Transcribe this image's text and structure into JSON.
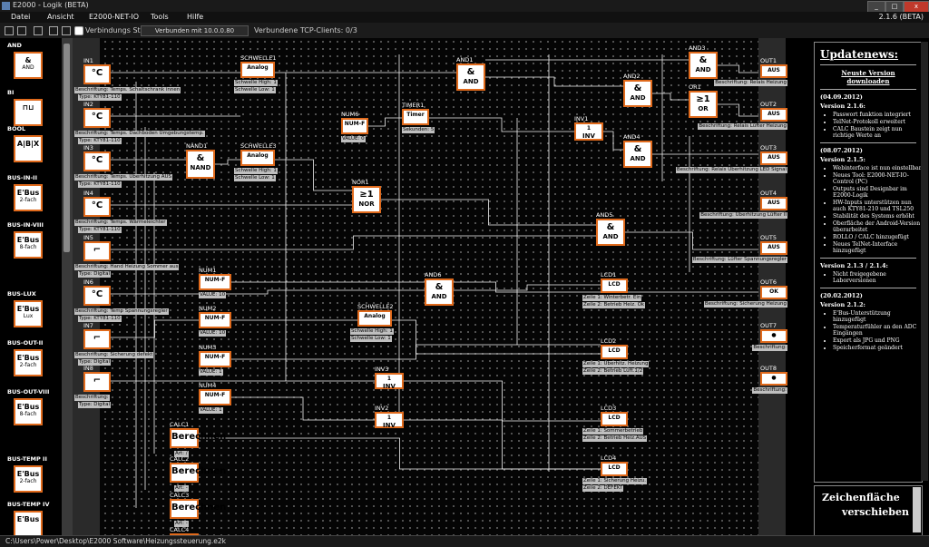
{
  "window": {
    "title": "E2000 - Logik (BETA)",
    "version": "2.1.6 (BETA)",
    "btn_min": "_",
    "btn_max": "□",
    "btn_close": "x"
  },
  "menu": [
    "Datei",
    "Ansicht",
    "E2000-NET-IO",
    "Tools",
    "Hilfe"
  ],
  "toolbar": {
    "status_label": "Verbindungs Status:",
    "status_value": "Verbunden mit 10.0.0.80",
    "tcp_clients": "Verbundene TCP-Clients: 0/3"
  },
  "palette": [
    {
      "cat": "AND",
      "sym": "&",
      "sub": "AND"
    },
    {
      "cat": "BI",
      "sym": "⊓⊔",
      "sub": ""
    },
    {
      "cat": "BOOL",
      "sym": "A|B|X",
      "sub": ""
    },
    {
      "cat": "BUS-IN-II",
      "sym": "E'Bus",
      "sub": "2-fach"
    },
    {
      "cat": "BUS-IN-VIII",
      "sym": "E'Bus",
      "sub": "8-fach"
    },
    {
      "cat": "BUS-LUX",
      "sym": "E'Bus",
      "sub": "Lux"
    },
    {
      "cat": "BUS-OUT-II",
      "sym": "E'Bus",
      "sub": "2-fach"
    },
    {
      "cat": "BUS-OUT-VIII",
      "sym": "E'Bus",
      "sub": "8-fach"
    },
    {
      "cat": "BUS-TEMP II",
      "sym": "E'Bus",
      "sub": "2-fach"
    },
    {
      "cat": "BUS-TEMP IV",
      "sym": "E'Bus",
      "sub": ""
    }
  ],
  "inputs": [
    {
      "name": "IN1",
      "sym": "°C",
      "sub": "KTY110",
      "desc": "Beschriftung: Temps. Schaltschrank innen",
      "type": "Type: KTY81-110"
    },
    {
      "name": "IN2",
      "sym": "°C",
      "sub": "KTY110",
      "desc": "Beschriftung: Temps. Dachboden Umgebungstemp.",
      "type": "Type: KTY81-110"
    },
    {
      "name": "IN3",
      "sym": "°C",
      "sub": "KTY110",
      "desc": "Beschriftung: Temps. Überhitzung AUS",
      "type": "Type: KTY81-110"
    },
    {
      "name": "IN4",
      "sym": "°C",
      "sub": "KTY110",
      "desc": "Beschriftung: Temps. Wärmeleichter",
      "type": "Type: KTY81-110"
    },
    {
      "name": "IN5",
      "sym": "⌐",
      "sub": "",
      "desc": "Beschriftung: Hand Heizung Sommer aus",
      "type": "Type: Digital"
    },
    {
      "name": "IN6",
      "sym": "°C",
      "sub": "KTY110",
      "desc": "Beschriftung: Temp Spannungsregler",
      "type": "Type: KTY81-110"
    },
    {
      "name": "IN7",
      "sym": "⌐",
      "sub": "",
      "desc": "Beschriftung: Sicherung defekt",
      "type": "Type: Digital"
    },
    {
      "name": "IN8",
      "sym": "⌐",
      "sub": "",
      "desc": "Beschriftung:",
      "type": "Type: Digital"
    }
  ],
  "outputs": [
    {
      "name": "OUT1",
      "sym": "AUS",
      "desc": "Beschriftung: Relais Heizung"
    },
    {
      "name": "OUT2",
      "sym": "AUS",
      "desc": "Beschriftung: Relais Lüfter Heizung"
    },
    {
      "name": "OUT3",
      "sym": "AUS",
      "desc": "Beschriftung: Relais Überhitzung LED Signal"
    },
    {
      "name": "OUT4",
      "sym": "AUS",
      "desc": "Beschriftung: Überhitzung Lüfter II"
    },
    {
      "name": "OUT5",
      "sym": "AUS",
      "desc": "Beschriftung: Lüfter Spannungsregler"
    },
    {
      "name": "OUT6",
      "sym": "OK",
      "desc": "Beschriftung: Sicherung Heizung"
    },
    {
      "name": "OUT7",
      "sym": "●",
      "desc": "Beschriftung:"
    },
    {
      "name": "OUT8",
      "sym": "●",
      "desc": "Beschriftung:"
    }
  ],
  "blocks": {
    "schwelle1": {
      "name": "SCHWELLE1",
      "sym": "Analog",
      "n1": "Schwelle High: 1",
      "n2": "Schwelle Low: 1"
    },
    "schwelle3": {
      "name": "SCHWELLE3",
      "sym": "Analog",
      "n1": "Schwelle High: 1",
      "n2": "Schwelle Low: 1"
    },
    "schwelle2": {
      "name": "SCHWELLE2",
      "sym": "Analog",
      "n1": "Schwelle High: 1",
      "n2": "Schwelle Low: 1"
    },
    "nand1": {
      "name": "NAND1",
      "sym": "&",
      "op": "NAND"
    },
    "num6": {
      "name": "NUM6",
      "sym": "NUM-F",
      "val": "VALUE: 0"
    },
    "timer1": {
      "name": "TIMER1",
      "sym": "Timer",
      "val": "Sekunden: 5"
    },
    "nor1": {
      "name": "NOR1",
      "sym": "≥1",
      "op": "NOR"
    },
    "and1": {
      "name": "AND1",
      "sym": "&",
      "op": "AND"
    },
    "and2": {
      "name": "AND2",
      "sym": "&",
      "op": "AND"
    },
    "and3": {
      "name": "AND3",
      "sym": "&",
      "op": "AND"
    },
    "and4": {
      "name": "AND4",
      "sym": "&",
      "op": "AND"
    },
    "and5": {
      "name": "AND5",
      "sym": "&",
      "op": "AND"
    },
    "and6": {
      "name": "AND6",
      "sym": "&",
      "op": "AND"
    },
    "or1": {
      "name": "OR1",
      "sym": "≥1",
      "op": "OR"
    },
    "inv1": {
      "name": "INV1",
      "sym": "1",
      "op": "INV"
    },
    "inv2": {
      "name": "INV2",
      "sym": "1",
      "op": "INV"
    },
    "inv3": {
      "name": "INV3",
      "sym": "1",
      "op": "INV"
    },
    "num1": {
      "name": "NUM1",
      "sym": "NUM-F",
      "val": "VALUE: 10"
    },
    "num2": {
      "name": "NUM2",
      "sym": "NUM-F",
      "val": "VALUE: 10"
    },
    "num3": {
      "name": "NUM3",
      "sym": "NUM-F",
      "val": "VALUE: 1"
    },
    "num4": {
      "name": "NUM4",
      "sym": "NUM-F",
      "val": "VALUE: 1"
    },
    "calc1": {
      "name": "CALC1",
      "sym": "Berechnen",
      "val": "Art: /"
    },
    "calc2": {
      "name": "CALC2",
      "sym": "Berechnen",
      "val": "Art: -"
    },
    "calc3": {
      "name": "CALC3",
      "sym": "Berechnen",
      "val": "Art: -"
    },
    "calc4": {
      "name": "CALC4",
      "sym": "",
      "val": ""
    },
    "lcd1": {
      "name": "LCD1",
      "sym": "LCD",
      "z1": "Zeile 1: Winterbetr.  Ein",
      "z2": "Zeile 2: Betrieb Heiz. Ok"
    },
    "lcd2": {
      "name": "LCD2",
      "sym": "LCD",
      "z1": "Zeile 1: Überhitz. Heizung",
      "z2": "Zeile 2: Betrieb Lüft.1/2"
    },
    "lcd3": {
      "name": "LCD3",
      "sym": "LCD",
      "z1": "Zeile 1: Sommerbetrieb",
      "z2": "Zeile 2: Betrieb Heiz.AUS"
    },
    "lcd4": {
      "name": "LCD4",
      "sym": "LCD",
      "z1": "Zeile 1: Sicherung Heizu.",
      "z2": "Zeile 2: DEFEKT"
    }
  },
  "news": {
    "title": "Updatenews:",
    "latest1": "Neuste Version",
    "latest2": "downloaden",
    "sections": [
      {
        "date": "(04.09.2012)",
        "ver": "Version 2.1.6:",
        "items": [
          "Passwort funktion integriert",
          "TelNet-Protokoll erweitert",
          "CALC Baustein zeigt nun richtige Werte an"
        ]
      },
      {
        "date": "(08.07.2012)",
        "ver": "Version 2.1.5:",
        "items": [
          "Webinterface ist nun einstellbar",
          "Neues Tool: E2000-NET-IO-Control (PC)",
          "Outputs sind Designbar im E2000-Logik",
          "HW-Inputs unterstützen nun auch KTY81-210 und TSL250",
          "Stabilität des Systems erhöht",
          "Oberfläche der Android-Version überarbeitet",
          "ROLLO / CALC hinzugefügt",
          "Neues TelNet-Interface hinzugefügt"
        ]
      },
      {
        "date": "",
        "ver": "Version 2.1.3 / 2.1.4:",
        "items": [
          "Nicht freigegebene Laborversionen"
        ]
      },
      {
        "date": "(20.02.2012)",
        "ver": "Version 2.1.2:",
        "items": [
          "E'Bus-Unterstützung hinzugefügt",
          "Temperaturfühler an den ADC Eingängen",
          "Export als JPG und PNG",
          "Speicherformat geändert"
        ]
      }
    ]
  },
  "draw_panel": {
    "line1": "Zeichenfläche",
    "line2": "verschieben"
  },
  "statusbar": {
    "path": "C:\\Users\\Power\\Desktop\\E2000 Software\\Heizungssteuerung.e2k"
  }
}
